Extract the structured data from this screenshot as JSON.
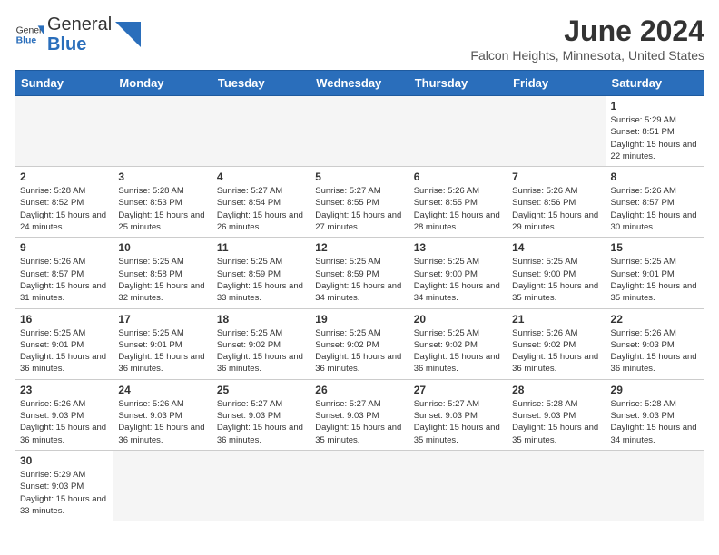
{
  "header": {
    "logo_text_general": "General",
    "logo_text_blue": "Blue",
    "month_title": "June 2024",
    "subtitle": "Falcon Heights, Minnesota, United States"
  },
  "weekdays": [
    "Sunday",
    "Monday",
    "Tuesday",
    "Wednesday",
    "Thursday",
    "Friday",
    "Saturday"
  ],
  "weeks": [
    [
      {
        "day": "",
        "info": ""
      },
      {
        "day": "",
        "info": ""
      },
      {
        "day": "",
        "info": ""
      },
      {
        "day": "",
        "info": ""
      },
      {
        "day": "",
        "info": ""
      },
      {
        "day": "",
        "info": ""
      },
      {
        "day": "1",
        "info": "Sunrise: 5:29 AM\nSunset: 8:51 PM\nDaylight: 15 hours and 22 minutes."
      }
    ],
    [
      {
        "day": "2",
        "info": "Sunrise: 5:28 AM\nSunset: 8:52 PM\nDaylight: 15 hours and 24 minutes."
      },
      {
        "day": "3",
        "info": "Sunrise: 5:28 AM\nSunset: 8:53 PM\nDaylight: 15 hours and 25 minutes."
      },
      {
        "day": "4",
        "info": "Sunrise: 5:27 AM\nSunset: 8:54 PM\nDaylight: 15 hours and 26 minutes."
      },
      {
        "day": "5",
        "info": "Sunrise: 5:27 AM\nSunset: 8:55 PM\nDaylight: 15 hours and 27 minutes."
      },
      {
        "day": "6",
        "info": "Sunrise: 5:26 AM\nSunset: 8:55 PM\nDaylight: 15 hours and 28 minutes."
      },
      {
        "day": "7",
        "info": "Sunrise: 5:26 AM\nSunset: 8:56 PM\nDaylight: 15 hours and 29 minutes."
      },
      {
        "day": "8",
        "info": "Sunrise: 5:26 AM\nSunset: 8:57 PM\nDaylight: 15 hours and 30 minutes."
      }
    ],
    [
      {
        "day": "9",
        "info": "Sunrise: 5:26 AM\nSunset: 8:57 PM\nDaylight: 15 hours and 31 minutes."
      },
      {
        "day": "10",
        "info": "Sunrise: 5:25 AM\nSunset: 8:58 PM\nDaylight: 15 hours and 32 minutes."
      },
      {
        "day": "11",
        "info": "Sunrise: 5:25 AM\nSunset: 8:59 PM\nDaylight: 15 hours and 33 minutes."
      },
      {
        "day": "12",
        "info": "Sunrise: 5:25 AM\nSunset: 8:59 PM\nDaylight: 15 hours and 34 minutes."
      },
      {
        "day": "13",
        "info": "Sunrise: 5:25 AM\nSunset: 9:00 PM\nDaylight: 15 hours and 34 minutes."
      },
      {
        "day": "14",
        "info": "Sunrise: 5:25 AM\nSunset: 9:00 PM\nDaylight: 15 hours and 35 minutes."
      },
      {
        "day": "15",
        "info": "Sunrise: 5:25 AM\nSunset: 9:01 PM\nDaylight: 15 hours and 35 minutes."
      }
    ],
    [
      {
        "day": "16",
        "info": "Sunrise: 5:25 AM\nSunset: 9:01 PM\nDaylight: 15 hours and 36 minutes."
      },
      {
        "day": "17",
        "info": "Sunrise: 5:25 AM\nSunset: 9:01 PM\nDaylight: 15 hours and 36 minutes."
      },
      {
        "day": "18",
        "info": "Sunrise: 5:25 AM\nSunset: 9:02 PM\nDaylight: 15 hours and 36 minutes."
      },
      {
        "day": "19",
        "info": "Sunrise: 5:25 AM\nSunset: 9:02 PM\nDaylight: 15 hours and 36 minutes."
      },
      {
        "day": "20",
        "info": "Sunrise: 5:25 AM\nSunset: 9:02 PM\nDaylight: 15 hours and 36 minutes."
      },
      {
        "day": "21",
        "info": "Sunrise: 5:26 AM\nSunset: 9:02 PM\nDaylight: 15 hours and 36 minutes."
      },
      {
        "day": "22",
        "info": "Sunrise: 5:26 AM\nSunset: 9:03 PM\nDaylight: 15 hours and 36 minutes."
      }
    ],
    [
      {
        "day": "23",
        "info": "Sunrise: 5:26 AM\nSunset: 9:03 PM\nDaylight: 15 hours and 36 minutes."
      },
      {
        "day": "24",
        "info": "Sunrise: 5:26 AM\nSunset: 9:03 PM\nDaylight: 15 hours and 36 minutes."
      },
      {
        "day": "25",
        "info": "Sunrise: 5:27 AM\nSunset: 9:03 PM\nDaylight: 15 hours and 36 minutes."
      },
      {
        "day": "26",
        "info": "Sunrise: 5:27 AM\nSunset: 9:03 PM\nDaylight: 15 hours and 35 minutes."
      },
      {
        "day": "27",
        "info": "Sunrise: 5:27 AM\nSunset: 9:03 PM\nDaylight: 15 hours and 35 minutes."
      },
      {
        "day": "28",
        "info": "Sunrise: 5:28 AM\nSunset: 9:03 PM\nDaylight: 15 hours and 35 minutes."
      },
      {
        "day": "29",
        "info": "Sunrise: 5:28 AM\nSunset: 9:03 PM\nDaylight: 15 hours and 34 minutes."
      }
    ],
    [
      {
        "day": "30",
        "info": "Sunrise: 5:29 AM\nSunset: 9:03 PM\nDaylight: 15 hours and 33 minutes."
      },
      {
        "day": "",
        "info": ""
      },
      {
        "day": "",
        "info": ""
      },
      {
        "day": "",
        "info": ""
      },
      {
        "day": "",
        "info": ""
      },
      {
        "day": "",
        "info": ""
      },
      {
        "day": "",
        "info": ""
      }
    ]
  ]
}
